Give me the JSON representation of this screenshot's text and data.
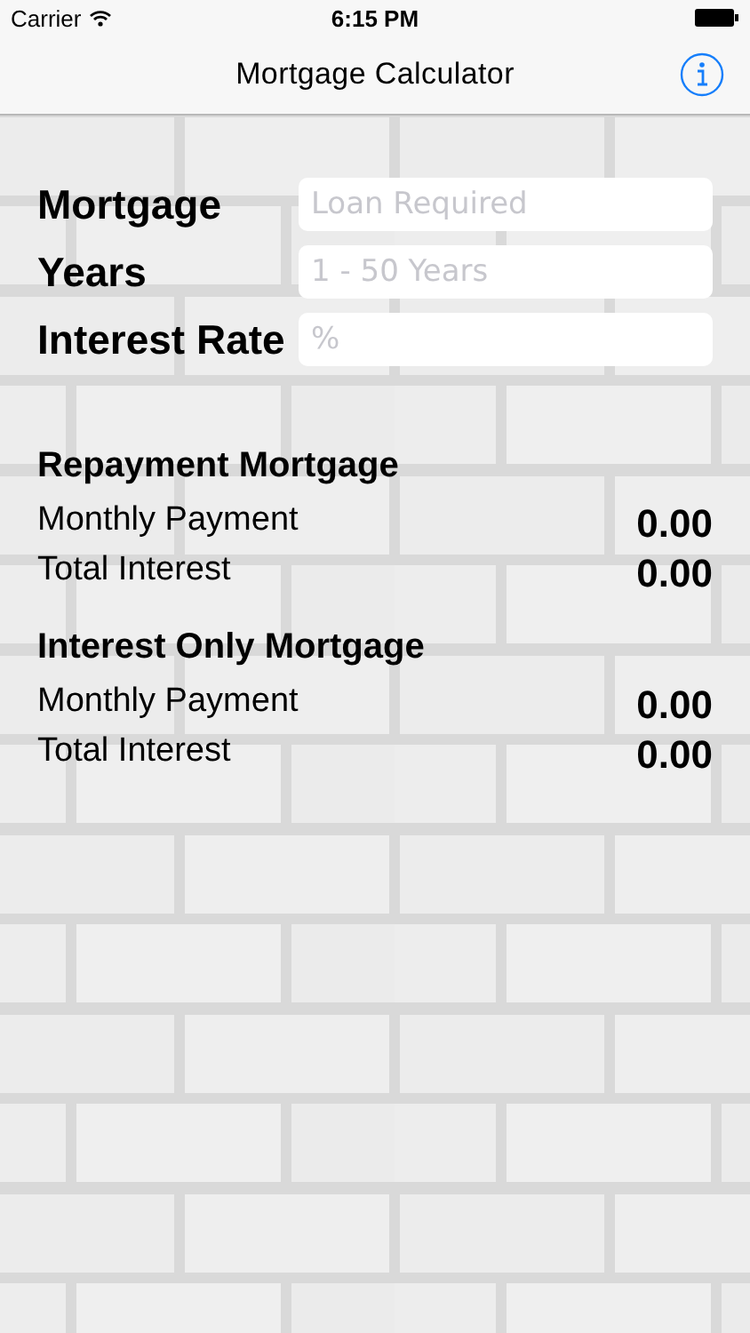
{
  "status_bar": {
    "carrier": "Carrier",
    "time": "6:15 PM"
  },
  "nav_bar": {
    "title": "Mortgage Calculator"
  },
  "form": {
    "fields": [
      {
        "label": "Mortgage",
        "placeholder": "Loan Required"
      },
      {
        "label": "Years",
        "placeholder": "1 - 50 Years"
      },
      {
        "label": "Interest Rate",
        "placeholder": "%"
      }
    ]
  },
  "sections": [
    {
      "title": "Repayment Mortgage",
      "rows": [
        {
          "label": "Monthly Payment",
          "value": "0.00"
        },
        {
          "label": "Total Interest",
          "value": "0.00"
        }
      ]
    },
    {
      "title": "Interest Only Mortgage",
      "rows": [
        {
          "label": "Monthly Payment",
          "value": "0.00"
        },
        {
          "label": "Total Interest",
          "value": "0.00"
        }
      ]
    }
  ]
}
